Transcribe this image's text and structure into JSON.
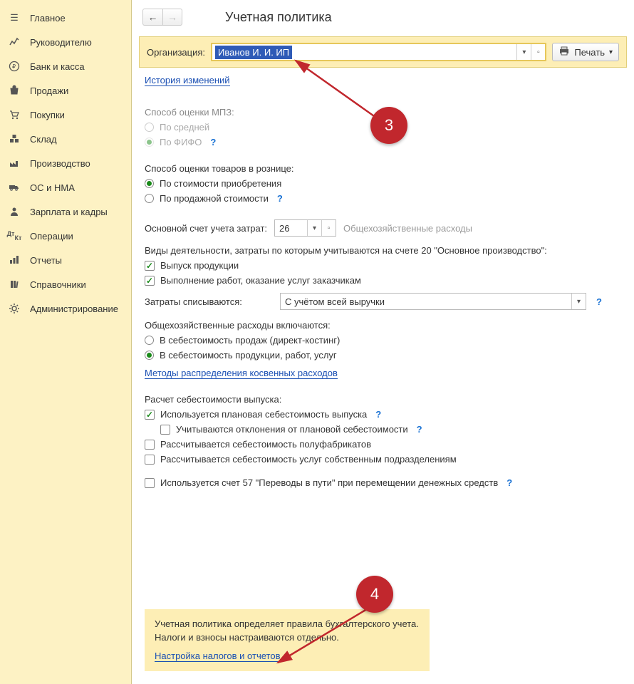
{
  "sidebar": {
    "items": [
      {
        "label": "Главное",
        "icon": "menu"
      },
      {
        "label": "Руководителю",
        "icon": "chart"
      },
      {
        "label": "Банк и касса",
        "icon": "ruble"
      },
      {
        "label": "Продажи",
        "icon": "bag"
      },
      {
        "label": "Покупки",
        "icon": "cart"
      },
      {
        "label": "Склад",
        "icon": "boxes"
      },
      {
        "label": "Производство",
        "icon": "factory"
      },
      {
        "label": "ОС и НМА",
        "icon": "truck"
      },
      {
        "label": "Зарплата и кадры",
        "icon": "person"
      },
      {
        "label": "Операции",
        "icon": "dtkt"
      },
      {
        "label": "Отчеты",
        "icon": "bars"
      },
      {
        "label": "Справочники",
        "icon": "books"
      },
      {
        "label": "Администрирование",
        "icon": "gear"
      }
    ]
  },
  "header": {
    "title": "Учетная политика",
    "org_label": "Организация:",
    "org_value": "Иванов И. И. ИП",
    "print_label": "Печать"
  },
  "links": {
    "history": "История изменений",
    "methods": "Методы распределения косвенных расходов",
    "tax_settings": "Настройка налогов и отчетов"
  },
  "mpz": {
    "title": "Способ оценки МПЗ:",
    "avg": "По средней",
    "fifo": "По ФИФО"
  },
  "retail": {
    "title": "Способ оценки товаров в рознице:",
    "cost": "По стоимости приобретения",
    "sale": "По продажной стоимости"
  },
  "costacct": {
    "label": "Основной счет учета затрат:",
    "value": "26",
    "hint": "Общехозяйственные расходы"
  },
  "activities": {
    "title": "Виды деятельности, затраты по которым учитываются на счете 20 \"Основное производство\":",
    "produce": "Выпуск продукции",
    "services": "Выполнение работ, оказание услуг заказчикам"
  },
  "writeoff": {
    "label": "Затраты списываются:",
    "value": "С учётом всей выручки"
  },
  "overhead": {
    "title": "Общехозяйственные расходы включаются:",
    "direct": "В себестоимость продаж (директ-костинг)",
    "full": "В  себестоимость продукции, работ, услуг"
  },
  "costcalc": {
    "title": "Расчет себестоимости выпуска:",
    "planned": "Используется плановая себестоимость выпуска",
    "deviations": "Учитываются отклонения от плановой себестоимости",
    "semi": "Рассчитывается себестоимость полуфабрикатов",
    "internal": "Рассчитывается себестоимость услуг собственным подразделениям"
  },
  "acct57": {
    "label": "Используется счет 57 \"Переводы в пути\" при перемещении денежных средств"
  },
  "footer": {
    "line1": "Учетная политика определяет правила бухгалтерского учета.",
    "line2": "Налоги и взносы настраиваются отдельно."
  },
  "callouts": {
    "c3": "3",
    "c4": "4"
  },
  "help": "?"
}
